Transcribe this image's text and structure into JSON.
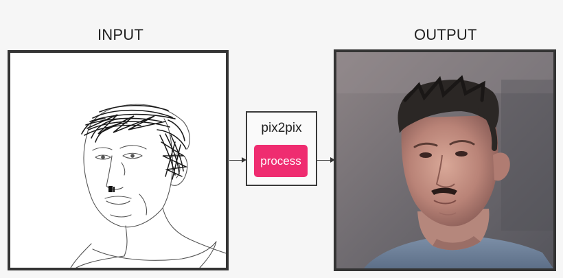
{
  "panels": {
    "input": {
      "title": "INPUT"
    },
    "output": {
      "title": "OUTPUT"
    }
  },
  "model": {
    "name": "pix2pix",
    "process_label": "process"
  },
  "colors": {
    "background": "#f6f6f6",
    "frame_border": "#343434",
    "process_button": "#ef2c70",
    "process_text": "#ffffff"
  },
  "icons": {
    "connector": "arrow-right-icon"
  }
}
